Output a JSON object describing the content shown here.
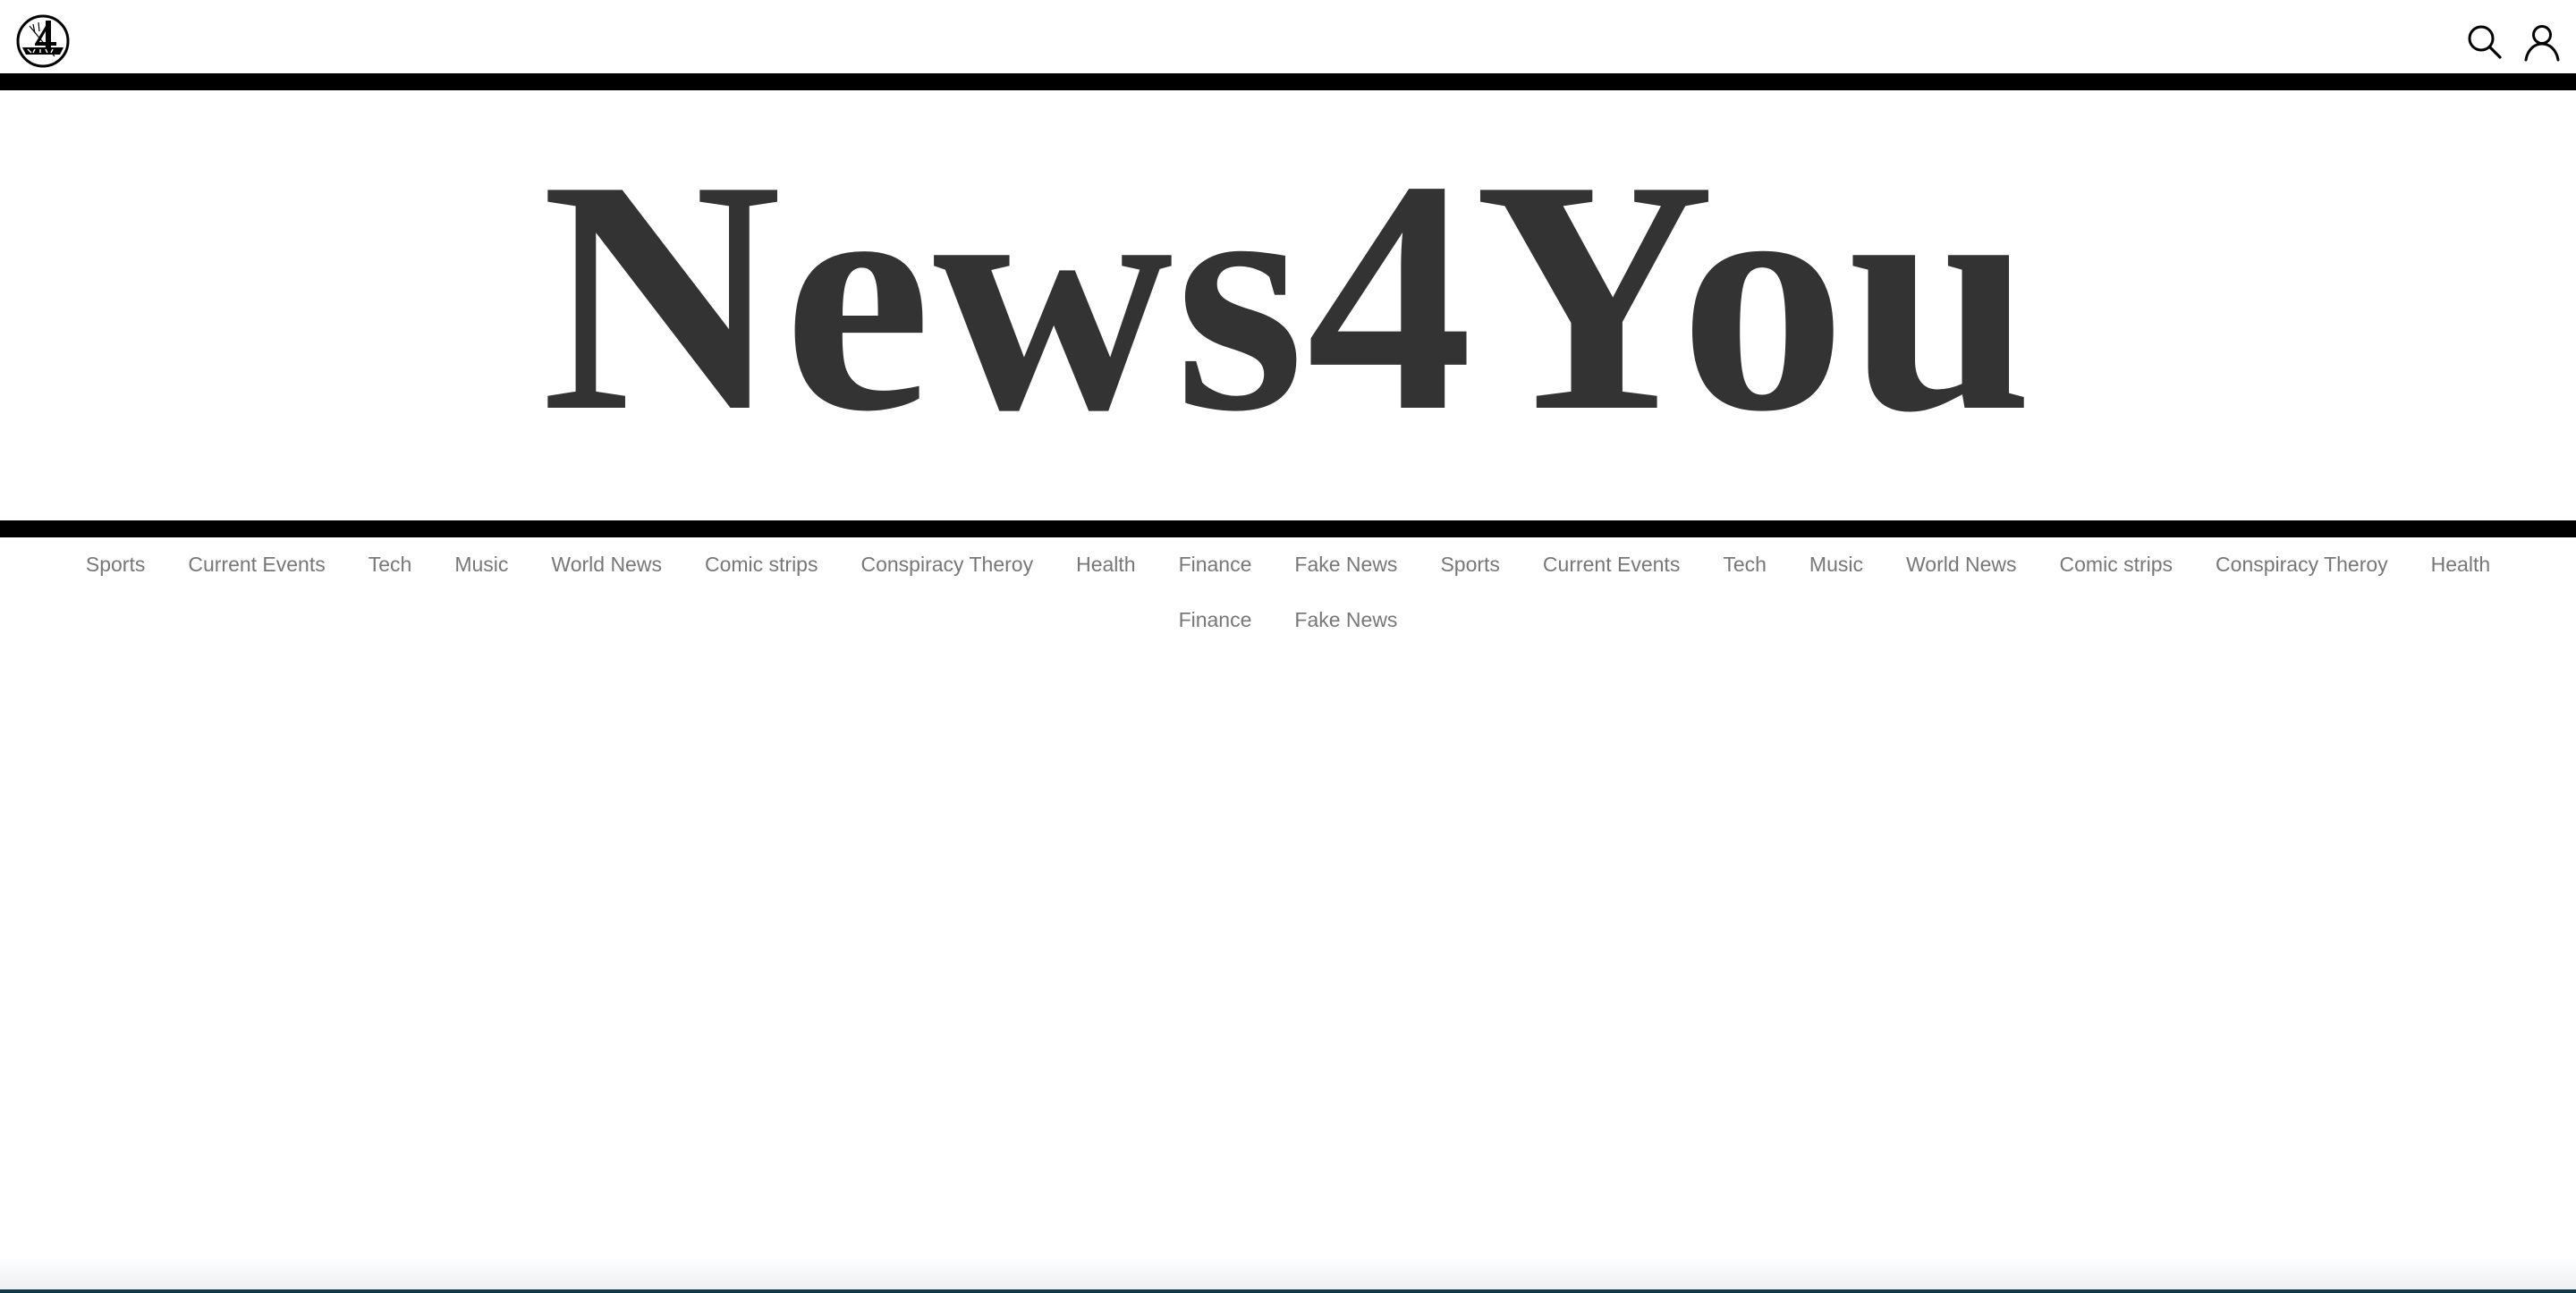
{
  "header": {
    "logo_icon": "news4you-logo-icon",
    "search_icon": "search-icon",
    "account_icon": "user-icon"
  },
  "masthead": {
    "title": "News4You"
  },
  "nav": {
    "items": [
      {
        "label": "Sports"
      },
      {
        "label": "Current Events"
      },
      {
        "label": "Tech"
      },
      {
        "label": "Music"
      },
      {
        "label": "World News"
      },
      {
        "label": "Comic strips"
      },
      {
        "label": "Conspiracy Theroy"
      },
      {
        "label": "Health"
      },
      {
        "label": "Finance"
      },
      {
        "label": "Fake News"
      },
      {
        "label": "Sports"
      },
      {
        "label": "Current Events"
      },
      {
        "label": "Tech"
      },
      {
        "label": "Music"
      },
      {
        "label": "World News"
      },
      {
        "label": "Comic strips"
      },
      {
        "label": "Conspiracy Theroy"
      },
      {
        "label": "Health"
      },
      {
        "label": "Finance"
      },
      {
        "label": "Fake News"
      }
    ]
  },
  "colors": {
    "title": "#333333",
    "nav_text": "#777777",
    "rule": "#000000",
    "background": "#ffffff"
  }
}
